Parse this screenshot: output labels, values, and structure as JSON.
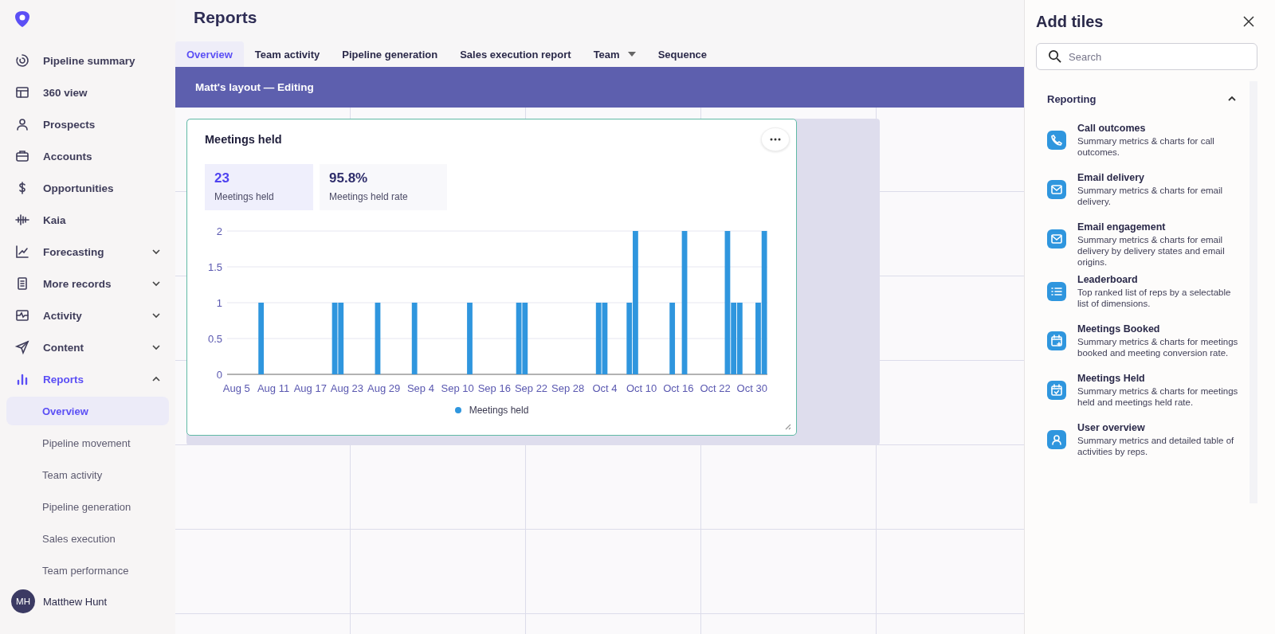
{
  "sidebar": {
    "items": [
      {
        "label": "Pipeline summary",
        "selected": false
      },
      {
        "label": "360 view",
        "selected": false
      },
      {
        "label": "Prospects",
        "selected": false
      },
      {
        "label": "Accounts",
        "selected": false
      },
      {
        "label": "Opportunities",
        "selected": false
      },
      {
        "label": "Kaia",
        "selected": false
      },
      {
        "label": "Forecasting",
        "selected": false,
        "expanded": false
      },
      {
        "label": "More records",
        "selected": false,
        "expanded": false
      },
      {
        "label": "Activity",
        "selected": false,
        "expanded": false
      },
      {
        "label": "Content",
        "selected": false,
        "expanded": false
      },
      {
        "label": "Reports",
        "selected": true,
        "expanded": true,
        "children": [
          {
            "label": "Overview",
            "selected": true
          },
          {
            "label": "Pipeline movement",
            "selected": false
          },
          {
            "label": "Team activity",
            "selected": false
          },
          {
            "label": "Pipeline generation",
            "selected": false
          },
          {
            "label": "Sales execution",
            "selected": false
          },
          {
            "label": "Team performance",
            "selected": false
          }
        ]
      }
    ],
    "user": {
      "initials": "MH",
      "name": "Matthew Hunt"
    }
  },
  "page": {
    "title": "Reports"
  },
  "tabs": [
    {
      "label": "Overview",
      "selected": true,
      "has_menu": false
    },
    {
      "label": "Team activity",
      "selected": false,
      "has_menu": false
    },
    {
      "label": "Pipeline generation",
      "selected": false,
      "has_menu": false
    },
    {
      "label": "Sales execution report",
      "selected": false,
      "has_menu": false
    },
    {
      "label": "Team",
      "selected": false,
      "has_menu": true
    },
    {
      "label": "Sequence",
      "selected": false,
      "has_menu": false
    }
  ],
  "banner": {
    "text": "Matt's layout — Editing"
  },
  "tile": {
    "title": "Meetings held",
    "metrics": [
      {
        "value": "23",
        "label": "Meetings held",
        "selected": true
      },
      {
        "value": "95.8%",
        "label": "Meetings held rate",
        "selected": false
      }
    ],
    "chart_data": {
      "type": "bar",
      "categories": [
        "Aug 5",
        null,
        null,
        null,
        null,
        null,
        "Aug 11",
        null,
        null,
        null,
        null,
        null,
        "Aug 17",
        null,
        null,
        null,
        null,
        null,
        "Aug 23",
        null,
        null,
        null,
        null,
        null,
        "Aug 29",
        null,
        null,
        null,
        null,
        null,
        "Sep 4",
        null,
        null,
        null,
        null,
        null,
        "Sep 10",
        null,
        null,
        null,
        null,
        null,
        "Sep 16",
        null,
        null,
        null,
        null,
        null,
        "Sep 22",
        null,
        null,
        null,
        null,
        null,
        "Sep 28",
        null,
        null,
        null,
        null,
        null,
        "Oct 4",
        null,
        null,
        null,
        null,
        null,
        "Oct 10",
        null,
        null,
        null,
        null,
        null,
        "Oct 16",
        null,
        null,
        null,
        null,
        null,
        "Oct 22",
        null,
        null,
        null,
        null,
        null,
        "Oct 30",
        null,
        null
      ],
      "series": [
        {
          "name": "Meetings held",
          "color": "#2f96de",
          "values": [
            0,
            0,
            0,
            0,
            1,
            0,
            0,
            0,
            0,
            0,
            0,
            0,
            0,
            0,
            0,
            0,
            1,
            1,
            0,
            0,
            0,
            0,
            0,
            1,
            0,
            0,
            0,
            0,
            0,
            1,
            0,
            0,
            0,
            0,
            0,
            0,
            0,
            0,
            1,
            0,
            0,
            0,
            0,
            0,
            0,
            0,
            1,
            1,
            0,
            0,
            0,
            0,
            0,
            0,
            0,
            0,
            0,
            0,
            0,
            1,
            1,
            0,
            0,
            0,
            1,
            2,
            0,
            0,
            0,
            0,
            0,
            1,
            0,
            2,
            0,
            0,
            0,
            0,
            0,
            0,
            2,
            1,
            1,
            0,
            0,
            1,
            2
          ]
        }
      ],
      "ylim": [
        0,
        2
      ],
      "yticks": [
        0,
        0.5,
        1,
        1.5,
        2
      ],
      "grid": true
    }
  },
  "panel": {
    "title": "Add tiles",
    "search": {
      "placeholder": "Search"
    },
    "section": {
      "label": "Reporting",
      "expanded": true,
      "items": [
        {
          "title": "Call outcomes",
          "description": "Summary metrics & charts for call outcomes."
        },
        {
          "title": "Email delivery",
          "description": "Summary metrics & charts for email delivery."
        },
        {
          "title": "Email engagement",
          "description": "Summary metrics & charts for email delivery by delivery states and email origins."
        },
        {
          "title": "Leaderboard",
          "description": "Top ranked list of reps by a selectable list of dimensions."
        },
        {
          "title": "Meetings Booked",
          "description": "Summary metrics & charts for meetings booked and meeting conversion rate."
        },
        {
          "title": "Meetings Held",
          "description": "Summary metrics & charts for meetings held and meetings held rate."
        },
        {
          "title": "User overview",
          "description": "Summary metrics and detailed table of activities by reps."
        }
      ]
    }
  }
}
